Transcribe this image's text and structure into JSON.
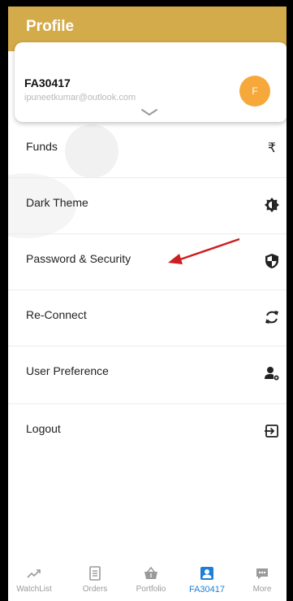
{
  "header": {
    "title": "Profile"
  },
  "profile": {
    "user_id": "FA30417",
    "email": "ipuneetkumar@outlook.com",
    "avatar_letter": "F"
  },
  "menu": {
    "items": [
      {
        "label": "Funds",
        "icon": "rupee-icon"
      },
      {
        "label": "Dark Theme",
        "icon": "brightness-icon"
      },
      {
        "label": "Password & Security",
        "icon": "shield-icon"
      },
      {
        "label": "Re-Connect",
        "icon": "sync-icon"
      },
      {
        "label": "User Preference",
        "icon": "user-settings-icon"
      },
      {
        "label": "Logout",
        "icon": "logout-icon"
      }
    ]
  },
  "rupee_symbol": "₹",
  "bottom_nav": {
    "tabs": [
      {
        "label": "WatchList",
        "icon": "trend-icon"
      },
      {
        "label": "Orders",
        "icon": "orders-icon"
      },
      {
        "label": "Portfolio",
        "icon": "basket-icon"
      },
      {
        "label": "FA30417",
        "icon": "profile-icon",
        "active": true
      },
      {
        "label": "More",
        "icon": "more-icon"
      }
    ]
  },
  "colors": {
    "header": "#d4ab4a",
    "avatar": "#f7a83a",
    "active_tab": "#1e7fd6",
    "arrow": "#cc1f1f"
  }
}
